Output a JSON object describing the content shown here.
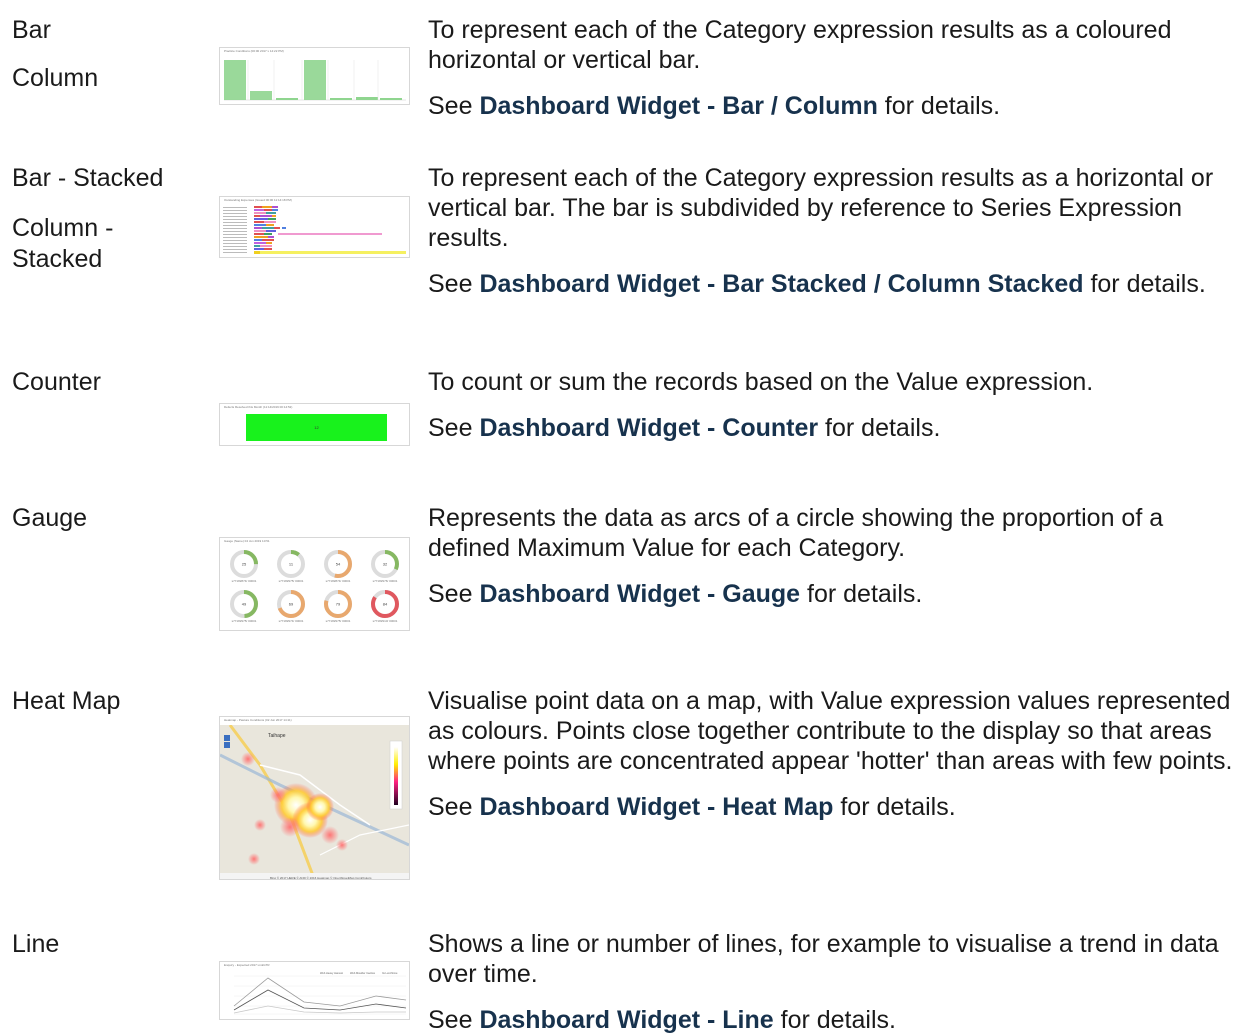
{
  "rows": [
    {
      "names": [
        "Bar",
        "Column"
      ],
      "description": "To represent each of the Category expression results as a col­oured horizontal or vertical bar.",
      "see_prefix": "See ",
      "link": "Dashboard Widget - Bar / Column",
      "see_suffix": " for details.",
      "thumb_title": "Practice Conditions (00:00 2017 x 14:22 PM)"
    },
    {
      "names": [
        "Bar - Stacked",
        "Column - Stacked"
      ],
      "description": "To represent each of the Category expression results as a hori­zontal or vertical bar. The bar is subdivided by reference to Series Expression results.",
      "see_prefix": "See ",
      "link": "Dashboard Widget - Bar Stacked / Column Stacked",
      "see_suffix": " for details.",
      "thumb_title": "Outstanding Expenses (Issued 00:00 11:14:18 PM)"
    },
    {
      "names": [
        "Counter"
      ],
      "description": "To count or sum the records based on the Value expression.",
      "see_prefix": "See ",
      "link": "Dashboard Widget - Counter",
      "see_suffix": " for details.",
      "thumb_title": "Defects Resolved this Month (11:14/2019 00:14:52)",
      "thumb_value": "12"
    },
    {
      "names": [
        "Gauge"
      ],
      "description": "Represents the data as arcs of a circle showing the proportion of a defined Maximum Value for each Category.",
      "see_prefix": "See ",
      "link": "Dashboard Widget - Gauge",
      "see_suffix": " for details.",
      "thumb_title": "Gauge (Name) 04 Jun 2019 10:51",
      "gauges": [
        {
          "value": "25",
          "label": "s77182874/ 00001",
          "color": "#86b862",
          "fraction": 0.25
        },
        {
          "value": "11",
          "label": "s77182975/ 00001",
          "color": "#86b862",
          "fraction": 0.11
        },
        {
          "value": "54",
          "label": "s77182874/ 00001",
          "color": "#e8a86e",
          "fraction": 0.54
        },
        {
          "value": "32",
          "label": "s77182976/ 00001",
          "color": "#86b862",
          "fraction": 0.32
        },
        {
          "value": "49",
          "label": "s77182975/ 00001",
          "color": "#86b862",
          "fraction": 0.49
        },
        {
          "value": "69",
          "label": "s77182974/ 00001",
          "color": "#e8a86e",
          "fraction": 0.69
        },
        {
          "value": "79",
          "label": "s77182975/ 00001",
          "color": "#e8a86e",
          "fraction": 0.79
        },
        {
          "value": "84",
          "label": "s77182910/ 00001",
          "color": "#e0585f",
          "fraction": 0.84
        }
      ]
    },
    {
      "names": [
        "Heat Map"
      ],
      "description": "Visualise point data on a map, with Value expression values represented as colours. Points close together contribute to the display so that areas where points are concentrated appear 'hotter' than areas with few points.",
      "see_prefix": "See ",
      "link": "Dashboard Widget - Heat Map",
      "see_suffix": " for details.",
      "thumb_title": "Heatmap - Pasture Conditions (02 Jun 2017 14:11)",
      "map_label": "Taihape",
      "map_footer": "Bing  © 2017 HERE © AND © 2016 Heatmap © OpenStreetMap Contributors"
    },
    {
      "names": [
        "Line"
      ],
      "description": "Shows a line or number of lines, for example to visualise a trend in data over time.",
      "see_prefix": "See ",
      "link": "Dashboard Widget - Line",
      "see_suffix": " for details.",
      "thumb_title": "Enquiry - Expected 2017 LinkGTR",
      "legend": [
        "Web Heavy Harvest",
        "Web Moulder Inactive",
        "Its Lunchtime"
      ]
    }
  ]
}
